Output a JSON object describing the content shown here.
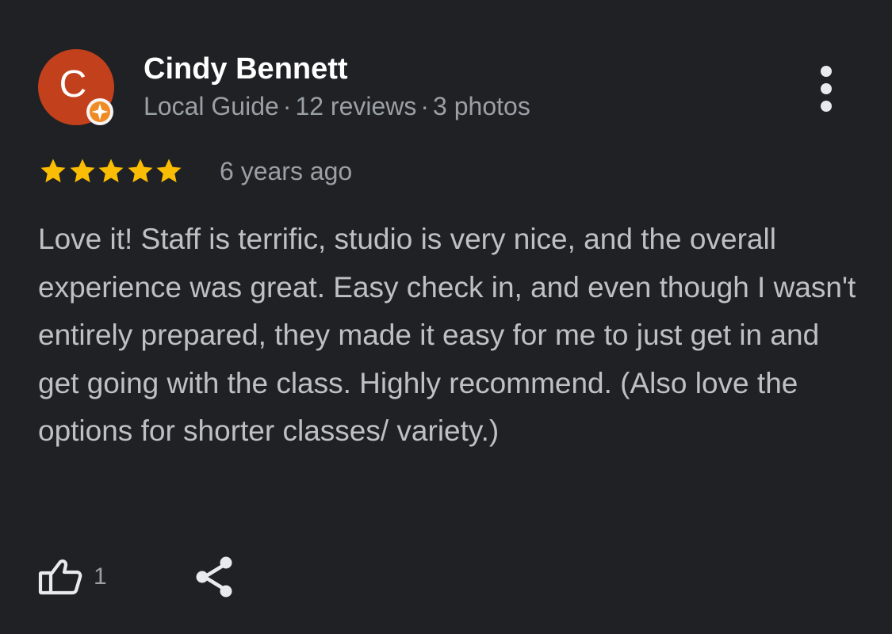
{
  "reviewer": {
    "initial": "C",
    "avatar_color": "#c2411c",
    "badge_icon": "local-guide-badge-icon",
    "name": "Cindy Bennett",
    "meta": {
      "level": "Local Guide",
      "reviews": "12 reviews",
      "photos": "3 photos",
      "separator": "·"
    }
  },
  "review": {
    "rating": 5,
    "max_rating": 5,
    "star_color": "#fbbc04",
    "time": "6 years ago",
    "text": "Love it! Staff is terrific, studio is very nice, and the overall experience was great. Easy check in, and even though I wasn't entirely prepared, they made it easy for me to just get in and get going with the class. Highly recommend. (Also love the options for shorter classes/ variety.)"
  },
  "actions": {
    "more_icon": "more-vertical-icon",
    "like_icon": "thumbs-up-icon",
    "like_count": "1",
    "share_icon": "share-icon"
  },
  "theme": {
    "background": "#202124",
    "primary_text": "#ffffff",
    "secondary_text": "#9aa0a6",
    "body_text": "#bdc1c6"
  }
}
